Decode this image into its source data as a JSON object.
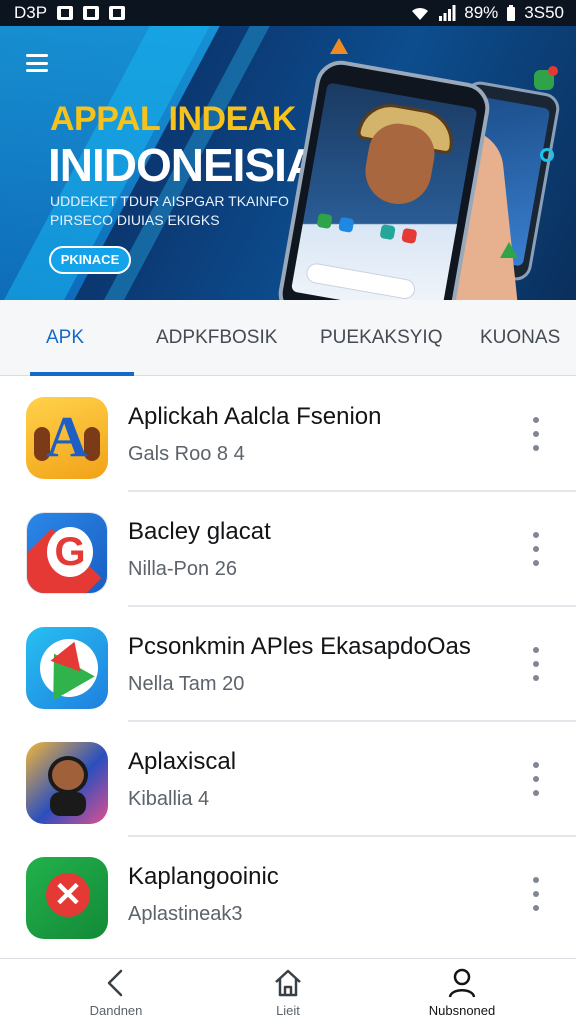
{
  "status_bar": {
    "left_text": "D3P",
    "battery": "89%",
    "time": "3S50"
  },
  "hero": {
    "title_line1": "APPAL INDEAK",
    "title_line2": "INIDONEISIA",
    "subtitle": "UDDEKET TDUR AISPGAR TKAINFO PIRSECO DIUIAS EKIGKS",
    "button_label": "PKINACE",
    "accent_yellow": "#f6c21b",
    "accent_blue": "#14a3ea"
  },
  "tabs": [
    {
      "label": "APK",
      "active": true
    },
    {
      "label": "ADPKFBOSIK",
      "active": false
    },
    {
      "label": "PUEKAKSYIQ",
      "active": false
    },
    {
      "label": "KUONAS",
      "active": false
    }
  ],
  "apps": [
    {
      "title": "Aplickah Aalcla Fsenion",
      "subtitle": "Gals Roo 8 4",
      "icon": "letter-a-icon"
    },
    {
      "title": "Bacley glacat",
      "subtitle": "Nilla-Pon 26",
      "icon": "g-logo-icon"
    },
    {
      "title": "Pcsonkmin APles EkasapdoOas",
      "subtitle": "Nella Tam 20",
      "icon": "maps-icon"
    },
    {
      "title": "Aplaxiscal",
      "subtitle": "Kiballia 4",
      "icon": "character-icon"
    },
    {
      "title": "Kaplangooinic",
      "subtitle": "Aplastineak3",
      "icon": "x-circle-icon"
    }
  ],
  "bottom_nav": [
    {
      "label": "Dandnen",
      "icon": "back-icon"
    },
    {
      "label": "Lieit",
      "icon": "home-icon"
    },
    {
      "label": "Nubsnoned",
      "icon": "profile-icon",
      "active": true
    }
  ],
  "colors": {
    "tab_active": "#1769c9",
    "status_bar": "#0c1420"
  }
}
